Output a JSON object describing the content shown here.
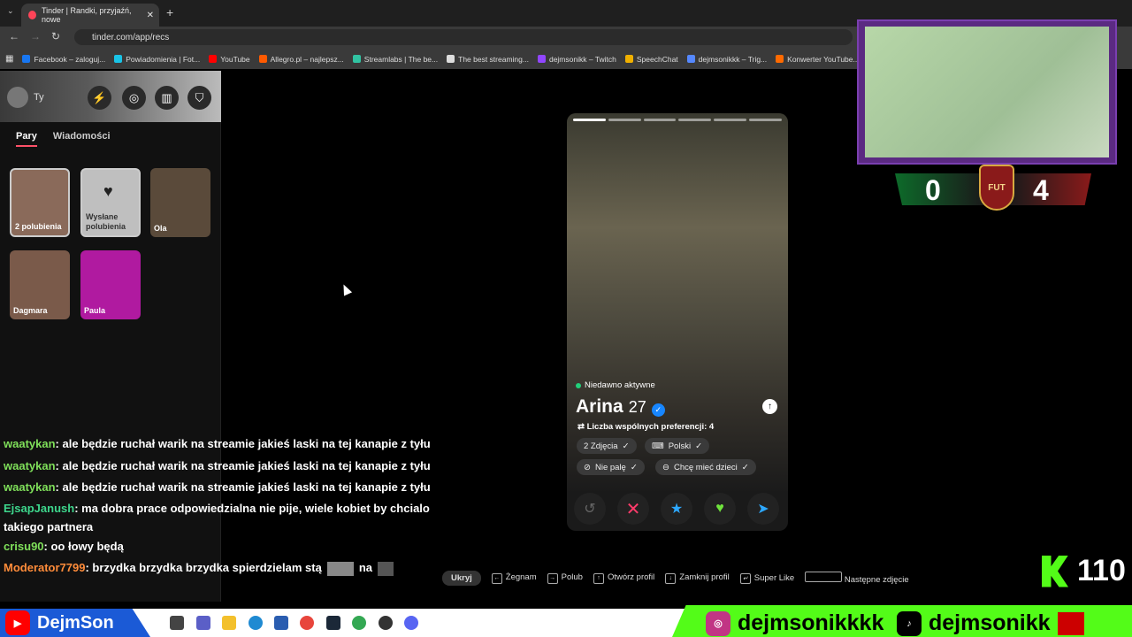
{
  "browser": {
    "tab_title": "Tinder | Randki, przyjaźń, nowe",
    "url": "tinder.com/app/recs",
    "bookmarks": [
      {
        "label": "Facebook – zaloguj...",
        "color": "#1877f2"
      },
      {
        "label": "Powiadomienia | Fot...",
        "color": "#19c3e6"
      },
      {
        "label": "YouTube",
        "color": "#ff0000"
      },
      {
        "label": "Allegro.pl – najlepsz...",
        "color": "#ff5a00"
      },
      {
        "label": "Streamlabs | The be...",
        "color": "#31c3a2"
      },
      {
        "label": "The best streaming...",
        "color": "#dddddd"
      },
      {
        "label": "dejmsonikk – Twitch",
        "color": "#9146ff"
      },
      {
        "label": "SpeechChat",
        "color": "#f0b000"
      },
      {
        "label": "dejmsonikkk – Trig...",
        "color": "#5588ff"
      },
      {
        "label": "Konwerter YouTube...",
        "color": "#ff6a00"
      }
    ]
  },
  "sidebar": {
    "me_label": "Ty",
    "tabs": [
      "Pary",
      "Wiadomości"
    ],
    "matches": [
      {
        "label": "2 polubienia",
        "color": "#8a6a5a"
      },
      {
        "label": "Wysłane polubienia",
        "color": "#bfbfbf"
      },
      {
        "label": "Ola",
        "color": "#5a4a3a"
      },
      {
        "label": "Dagmara",
        "color": "#7a5a4a"
      },
      {
        "label": "Paula",
        "color": "#b01aa0"
      }
    ]
  },
  "chat": [
    {
      "user": "waatykan",
      "color": "#7fe05a",
      "text": ": ale będzie ruchał warik na streamie jakieś laski na tej kanapie z tyłu"
    },
    {
      "user": "waatykan",
      "color": "#7fe05a",
      "text": ": ale będzie ruchał warik na streamie jakieś laski na tej kanapie z tyłu"
    },
    {
      "user": "waatykan",
      "color": "#7fe05a",
      "text": ": ale będzie ruchał warik na streamie jakieś laski na tej kanapie z tyłu"
    },
    {
      "user": "EjsapJanush",
      "color": "#3dd68c",
      "text": ": ma dobra prace odpowiedzialna nie pije, wiele kobiet by chcialo takiego partnera"
    },
    {
      "user": "crisu90",
      "color": "#7fe05a",
      "text": ": oo łowy będą"
    },
    {
      "user": "Moderator7799",
      "color": "#ff8c3a",
      "text": ": brzydka brzydka brzydka spierdzielam stą"
    }
  ],
  "chat_extra": "na",
  "card": {
    "status": "Niedawno aktywne",
    "name": "Arina",
    "age": "27",
    "prefs": "Liczba wspólnych preferencji: 4",
    "chips": [
      "2 Zdjęcia",
      "Polski",
      "Nie palę",
      "Chcę mieć dzieci"
    ]
  },
  "hints": {
    "hide": "Ukryj",
    "nope": "Żegnam",
    "like": "Polub",
    "open": "Otwórz profil",
    "close": "Zamknij profil",
    "super": "Super Like",
    "next": "Następne zdjęcie"
  },
  "score": {
    "left": "0",
    "right": "4",
    "badge": "FUT"
  },
  "kick_count": "110",
  "social": {
    "youtube": "DejmSon",
    "instagram": "dejmsonikkkk",
    "tiktok": "dejmsonikk"
  }
}
